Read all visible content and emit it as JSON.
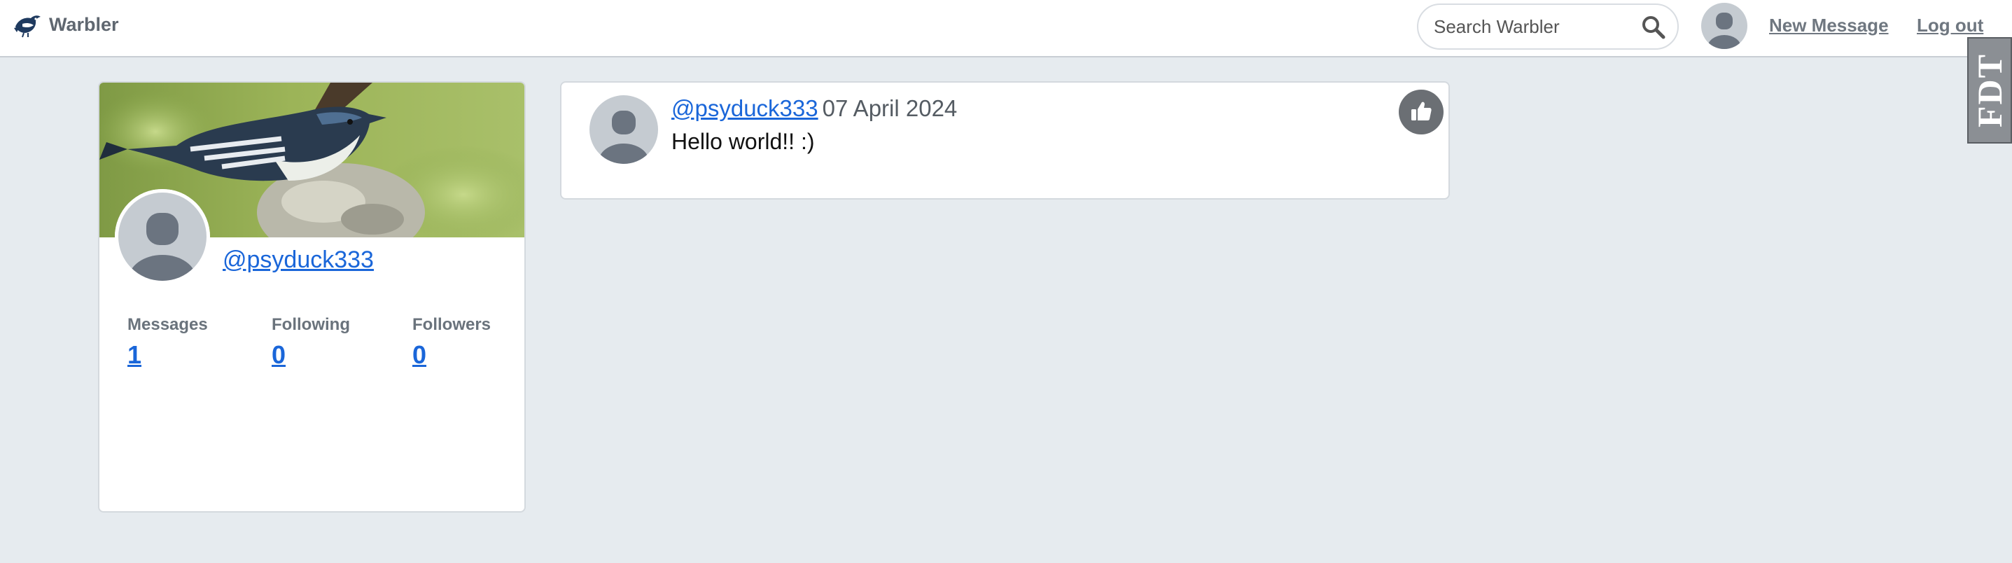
{
  "navbar": {
    "brand": "Warbler",
    "search_placeholder": "Search Warbler",
    "new_message": "New Message",
    "logout": "Log out",
    "debug_toolbar": "FDT"
  },
  "profile": {
    "username": "@psyduck333",
    "stats": [
      {
        "label": "Messages",
        "value": "1"
      },
      {
        "label": "Following",
        "value": "0"
      },
      {
        "label": "Followers",
        "value": "0"
      }
    ]
  },
  "messages": [
    {
      "user": "@psyduck333",
      "date": "07 April 2024",
      "text": "Hello world!! :)"
    }
  ],
  "colors": {
    "page_bg": "#e6ebef",
    "link": "#1a66d9",
    "like_button": "#6b6f74",
    "avatar_bg": "#c5cbd1",
    "avatar_fg": "#6b7480"
  },
  "icons": {
    "brand": "warbler-bird-logo",
    "search": "search-icon",
    "like": "thumbs-up-icon",
    "avatar": "default-avatar-icon"
  }
}
